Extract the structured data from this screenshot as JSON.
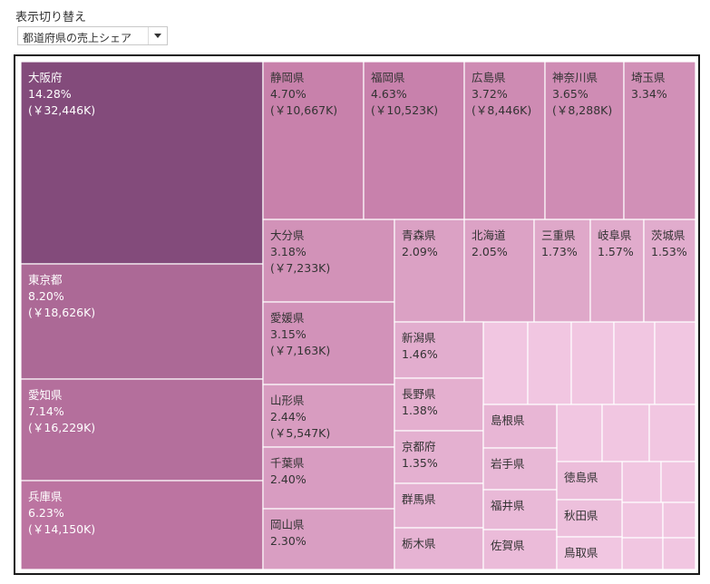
{
  "filter": {
    "label": "表示切り替え",
    "selected": "都道府県の売上シェア"
  },
  "colors": {
    "high": "#834b7b",
    "mid": "#c47aa6",
    "low": "#f1c6e1"
  },
  "chart_data": {
    "type": "treemap",
    "title": "",
    "items": [
      {
        "name": "大阪府",
        "share": "14.28%",
        "sales": "(￥32,446K)",
        "value": 32446
      },
      {
        "name": "東京都",
        "share": "8.20%",
        "sales": "(￥18,626K)",
        "value": 18626
      },
      {
        "name": "愛知県",
        "share": "7.14%",
        "sales": "(￥16,229K)",
        "value": 16229
      },
      {
        "name": "兵庫県",
        "share": "6.23%",
        "sales": "(￥14,150K)",
        "value": 14150
      },
      {
        "name": "静岡県",
        "share": "4.70%",
        "sales": "(￥10,667K)",
        "value": 10667
      },
      {
        "name": "福岡県",
        "share": "4.63%",
        "sales": "(￥10,523K)",
        "value": 10523
      },
      {
        "name": "広島県",
        "share": "3.72%",
        "sales": "(￥8,446K)",
        "value": 8446
      },
      {
        "name": "神奈川県",
        "share": "3.65%",
        "sales": "(￥8,288K)",
        "value": 8288
      },
      {
        "name": "埼玉県",
        "share": "3.34%",
        "sales": "",
        "value": 7590
      },
      {
        "name": "大分県",
        "share": "3.18%",
        "sales": "(￥7,233K)",
        "value": 7233
      },
      {
        "name": "愛媛県",
        "share": "3.15%",
        "sales": "(￥7,163K)",
        "value": 7163
      },
      {
        "name": "山形県",
        "share": "2.44%",
        "sales": "(￥5,547K)",
        "value": 5547
      },
      {
        "name": "千葉県",
        "share": "2.40%",
        "sales": "",
        "value": 5450
      },
      {
        "name": "岡山県",
        "share": "2.30%",
        "sales": "",
        "value": 5230
      },
      {
        "name": "青森県",
        "share": "2.09%",
        "sales": "",
        "value": 4750
      },
      {
        "name": "北海道",
        "share": "2.05%",
        "sales": "",
        "value": 4660
      },
      {
        "name": "三重県",
        "share": "1.73%",
        "sales": "",
        "value": 3930
      },
      {
        "name": "岐阜県",
        "share": "1.57%",
        "sales": "",
        "value": 3570
      },
      {
        "name": "茨城県",
        "share": "1.53%",
        "sales": "",
        "value": 3480
      },
      {
        "name": "新潟県",
        "share": "1.46%",
        "sales": "",
        "value": 3320
      },
      {
        "name": "長野県",
        "share": "1.38%",
        "sales": "",
        "value": 3140
      },
      {
        "name": "京都府",
        "share": "1.35%",
        "sales": "",
        "value": 3070
      },
      {
        "name": "群馬県",
        "share": "",
        "sales": "",
        "value": 2900
      },
      {
        "name": "栃木県",
        "share": "",
        "sales": "",
        "value": 2800
      },
      {
        "name": "島根県",
        "share": "",
        "sales": "",
        "value": 2600
      },
      {
        "name": "岩手県",
        "share": "",
        "sales": "",
        "value": 2500
      },
      {
        "name": "福井県",
        "share": "",
        "sales": "",
        "value": 2400
      },
      {
        "name": "佐賀県",
        "share": "",
        "sales": "",
        "value": 2300
      },
      {
        "name": "徳島県",
        "share": "",
        "sales": "",
        "value": 2200
      },
      {
        "name": "秋田県",
        "share": "",
        "sales": "",
        "value": 2100
      },
      {
        "name": "鳥取県",
        "share": "",
        "sales": "",
        "value": 2000
      }
    ]
  }
}
